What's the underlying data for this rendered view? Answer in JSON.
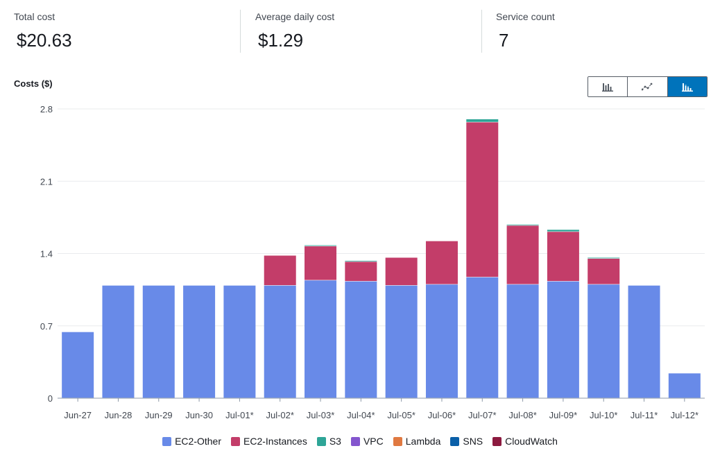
{
  "summary": {
    "total_cost_label": "Total cost",
    "total_cost_value": "$20.63",
    "avg_daily_label": "Average daily cost",
    "avg_daily_value": "$1.29",
    "service_count_label": "Service count",
    "service_count_value": "7"
  },
  "chart_toggle": {
    "options": [
      {
        "icon": "bar-chart-icon",
        "active": false
      },
      {
        "icon": "line-chart-icon",
        "active": false
      },
      {
        "icon": "stacked-bar-chart-icon",
        "active": true
      }
    ],
    "active_color": "#0073bb"
  },
  "chart_data": {
    "type": "bar",
    "stacked": true,
    "ylabel": "Costs ($)",
    "xlabel": "",
    "ylim": [
      0,
      2.8
    ],
    "yticks": [
      0,
      0.7,
      1.4,
      2.1,
      2.8
    ],
    "ytick_labels": [
      "0",
      "0.7",
      "1.4",
      "2.1",
      "2.8"
    ],
    "grid": true,
    "legend_position": "bottom-center",
    "categories": [
      "Jun-27",
      "Jun-28",
      "Jun-29",
      "Jun-30",
      "Jul-01*",
      "Jul-02*",
      "Jul-03*",
      "Jul-04*",
      "Jul-05*",
      "Jul-06*",
      "Jul-07*",
      "Jul-08*",
      "Jul-09*",
      "Jul-10*",
      "Jul-11*",
      "Jul-12*"
    ],
    "series": [
      {
        "name": "EC2-Other",
        "color": "#688ae8",
        "values": [
          0.64,
          1.09,
          1.09,
          1.09,
          1.09,
          1.09,
          1.14,
          1.13,
          1.09,
          1.1,
          1.17,
          1.1,
          1.13,
          1.1,
          1.09,
          0.24
        ]
      },
      {
        "name": "EC2-Instances",
        "color": "#c33d69",
        "values": [
          0,
          0,
          0,
          0,
          0,
          0.29,
          0.33,
          0.19,
          0.27,
          0.42,
          1.5,
          0.57,
          0.48,
          0.25,
          0,
          0
        ]
      },
      {
        "name": "S3",
        "color": "#2ea597",
        "values": [
          0,
          0,
          0,
          0,
          0,
          0,
          0.01,
          0.01,
          0,
          0,
          0.03,
          0.01,
          0.02,
          0.01,
          0,
          0
        ]
      },
      {
        "name": "VPC",
        "color": "#8456ce",
        "values": [
          0,
          0,
          0,
          0,
          0,
          0,
          0,
          0,
          0,
          0,
          0,
          0,
          0,
          0,
          0,
          0
        ]
      },
      {
        "name": "Lambda",
        "color": "#e07941",
        "values": [
          0,
          0,
          0,
          0,
          0,
          0,
          0,
          0,
          0,
          0,
          0,
          0,
          0,
          0,
          0,
          0
        ]
      },
      {
        "name": "SNS",
        "color": "#3759ce",
        "values": [
          0,
          0,
          0,
          0,
          0,
          0,
          0,
          0,
          0,
          0,
          0,
          0,
          0,
          0,
          0,
          0
        ]
      },
      {
        "name": "CloudWatch",
        "color": "#962249",
        "values": [
          0,
          0,
          0,
          0,
          0,
          0,
          0,
          0,
          0,
          0,
          0,
          0,
          0,
          0,
          0,
          0
        ]
      }
    ]
  },
  "legend": {
    "items": [
      {
        "label": "EC2-Other",
        "color": "#688ae8"
      },
      {
        "label": "EC2-Instances",
        "color": "#c33d69"
      },
      {
        "label": "S3",
        "color": "#2ea597"
      },
      {
        "label": "VPC",
        "color": "#8456ce"
      },
      {
        "label": "Lambda",
        "color": "#e07941"
      },
      {
        "label": "SNS",
        "color": "#0a5fa8"
      },
      {
        "label": "CloudWatch",
        "color": "#8c1a3f"
      }
    ]
  }
}
